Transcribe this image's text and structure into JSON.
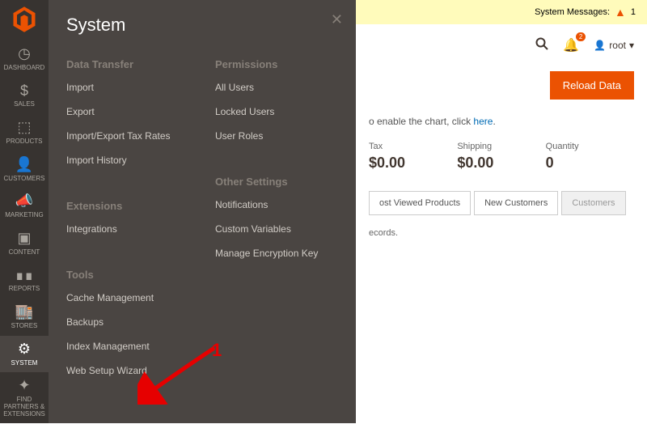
{
  "sidebar": {
    "items": [
      {
        "label": "DASHBOARD",
        "icon": "⏱"
      },
      {
        "label": "SALES",
        "icon": "$"
      },
      {
        "label": "PRODUCTS",
        "icon": "⬚"
      },
      {
        "label": "CUSTOMERS",
        "icon": "👤"
      },
      {
        "label": "MARKETING",
        "icon": "📣"
      },
      {
        "label": "CONTENT",
        "icon": "▣"
      },
      {
        "label": "REPORTS",
        "icon": "📊"
      },
      {
        "label": "STORES",
        "icon": "🏬"
      },
      {
        "label": "SYSTEM",
        "icon": "⚙"
      },
      {
        "label": "FIND PARTNERS & EXTENSIONS",
        "icon": "✦"
      }
    ]
  },
  "flyout": {
    "title": "System",
    "groups": {
      "data_transfer": {
        "title": "Data Transfer",
        "items": [
          "Import",
          "Export",
          "Import/Export Tax Rates",
          "Import History"
        ]
      },
      "extensions": {
        "title": "Extensions",
        "items": [
          "Integrations"
        ]
      },
      "tools": {
        "title": "Tools",
        "items": [
          "Cache Management",
          "Backups",
          "Index Management",
          "Web Setup Wizard"
        ]
      },
      "permissions": {
        "title": "Permissions",
        "items": [
          "All Users",
          "Locked Users",
          "User Roles"
        ]
      },
      "other": {
        "title": "Other Settings",
        "items": [
          "Notifications",
          "Custom Variables",
          "Manage Encryption Key"
        ]
      }
    }
  },
  "header": {
    "system_messages_label": "System Messages:",
    "system_messages_count": "1",
    "notifications_count": "2",
    "username": "root",
    "reload_label": "Reload Data"
  },
  "chart_note": {
    "prefix": "o enable the chart, click ",
    "link": "here"
  },
  "stats": [
    {
      "label": "Tax",
      "value": "$0.00"
    },
    {
      "label": "Shipping",
      "value": "$0.00"
    },
    {
      "label": "Quantity",
      "value": "0"
    }
  ],
  "tabs": [
    "ost Viewed Products",
    "New Customers",
    "Customers"
  ],
  "records_text": "ecords.",
  "annotation": {
    "number": "1"
  }
}
